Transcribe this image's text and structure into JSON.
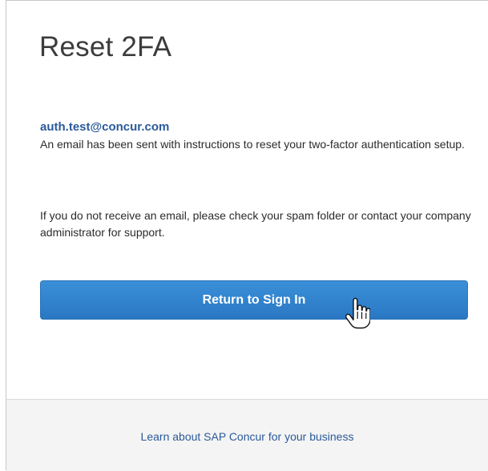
{
  "page": {
    "title": "Reset 2FA"
  },
  "account": {
    "email": "auth.test@concur.com"
  },
  "messages": {
    "sent": "An email has been sent with instructions to reset your two-factor authentication setup.",
    "help": "If you do not receive an email, please check your spam folder or contact your company administrator for support."
  },
  "actions": {
    "return_label": "Return to Sign In"
  },
  "footer": {
    "link": "Learn about SAP Concur for your business"
  },
  "colors": {
    "accent": "#2a78c4",
    "link": "#2a5a9a",
    "footer_bg": "#f4f4f4"
  },
  "icons": {
    "pointer": "hand-cursor-icon"
  }
}
